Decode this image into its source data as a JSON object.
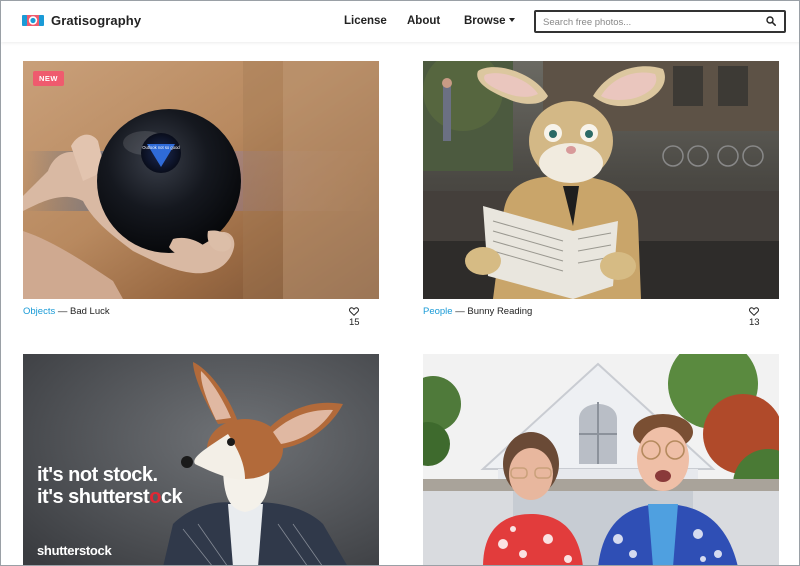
{
  "header": {
    "brand": "Gratisography",
    "nav": {
      "license": "License",
      "about": "About",
      "browse": "Browse"
    },
    "search_placeholder": "Search free photos..."
  },
  "cards": [
    {
      "badge": "NEW",
      "category": "Objects",
      "separator": " — ",
      "title": "Bad Luck",
      "likes": "15",
      "image_label": "Outlook not so good"
    },
    {
      "category": "People",
      "separator": " — ",
      "title": "Bunny Reading",
      "likes": "13"
    },
    {
      "ad_line1": "it's not stock.",
      "ad_line2_a": "it's shutterst",
      "ad_line2_b": "ck",
      "ad_brand": "shutterstock"
    },
    {}
  ],
  "colors": {
    "accent": "#1a9bd7",
    "badge": "#ef5b6e",
    "shutterstock_red": "#e22834"
  }
}
